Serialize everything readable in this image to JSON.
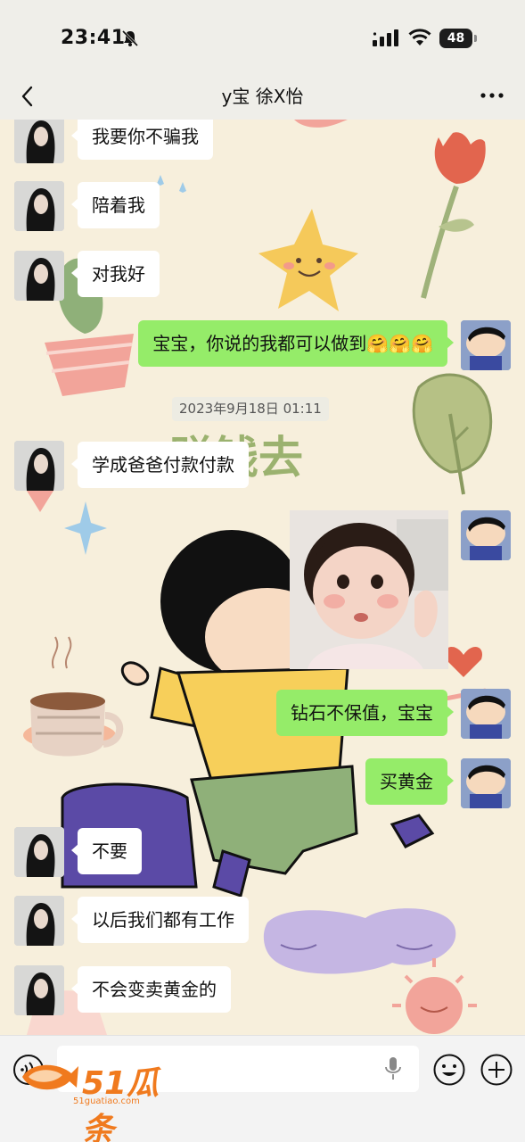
{
  "status_bar": {
    "time": "23:41",
    "battery": "48"
  },
  "header": {
    "title": "y宝 徐X怡"
  },
  "messages": [
    {
      "side": "in",
      "text": "我要你不骗我"
    },
    {
      "side": "in",
      "text": "陪着我"
    },
    {
      "side": "in",
      "text": "对我好"
    },
    {
      "side": "out",
      "text": "宝宝，你说的我都可以做到🤗🤗🤗"
    },
    {
      "side": "in",
      "text": "学成爸爸付款付款"
    },
    {
      "side": "out",
      "text": "钻石不保值，宝宝"
    },
    {
      "side": "out",
      "text": "买黄金"
    },
    {
      "side": "in",
      "text": "不要"
    },
    {
      "side": "in",
      "text": "以后我们都有工作"
    },
    {
      "side": "in",
      "text": "不会变卖黄金的"
    }
  ],
  "timestamp": "2023年9月18日 01:11",
  "wallpaper_text": "赚钱去",
  "watermark": {
    "logo": "51瓜条",
    "url": "51guatiao.com"
  },
  "colors": {
    "out_bubble": "#95ec69",
    "in_bubble": "#ffffff",
    "background": "#f7efdc"
  },
  "icons": [
    "back-arrow-icon",
    "more-dots-icon",
    "voice-icon",
    "microphone-icon",
    "emoji-icon",
    "plus-icon"
  ]
}
